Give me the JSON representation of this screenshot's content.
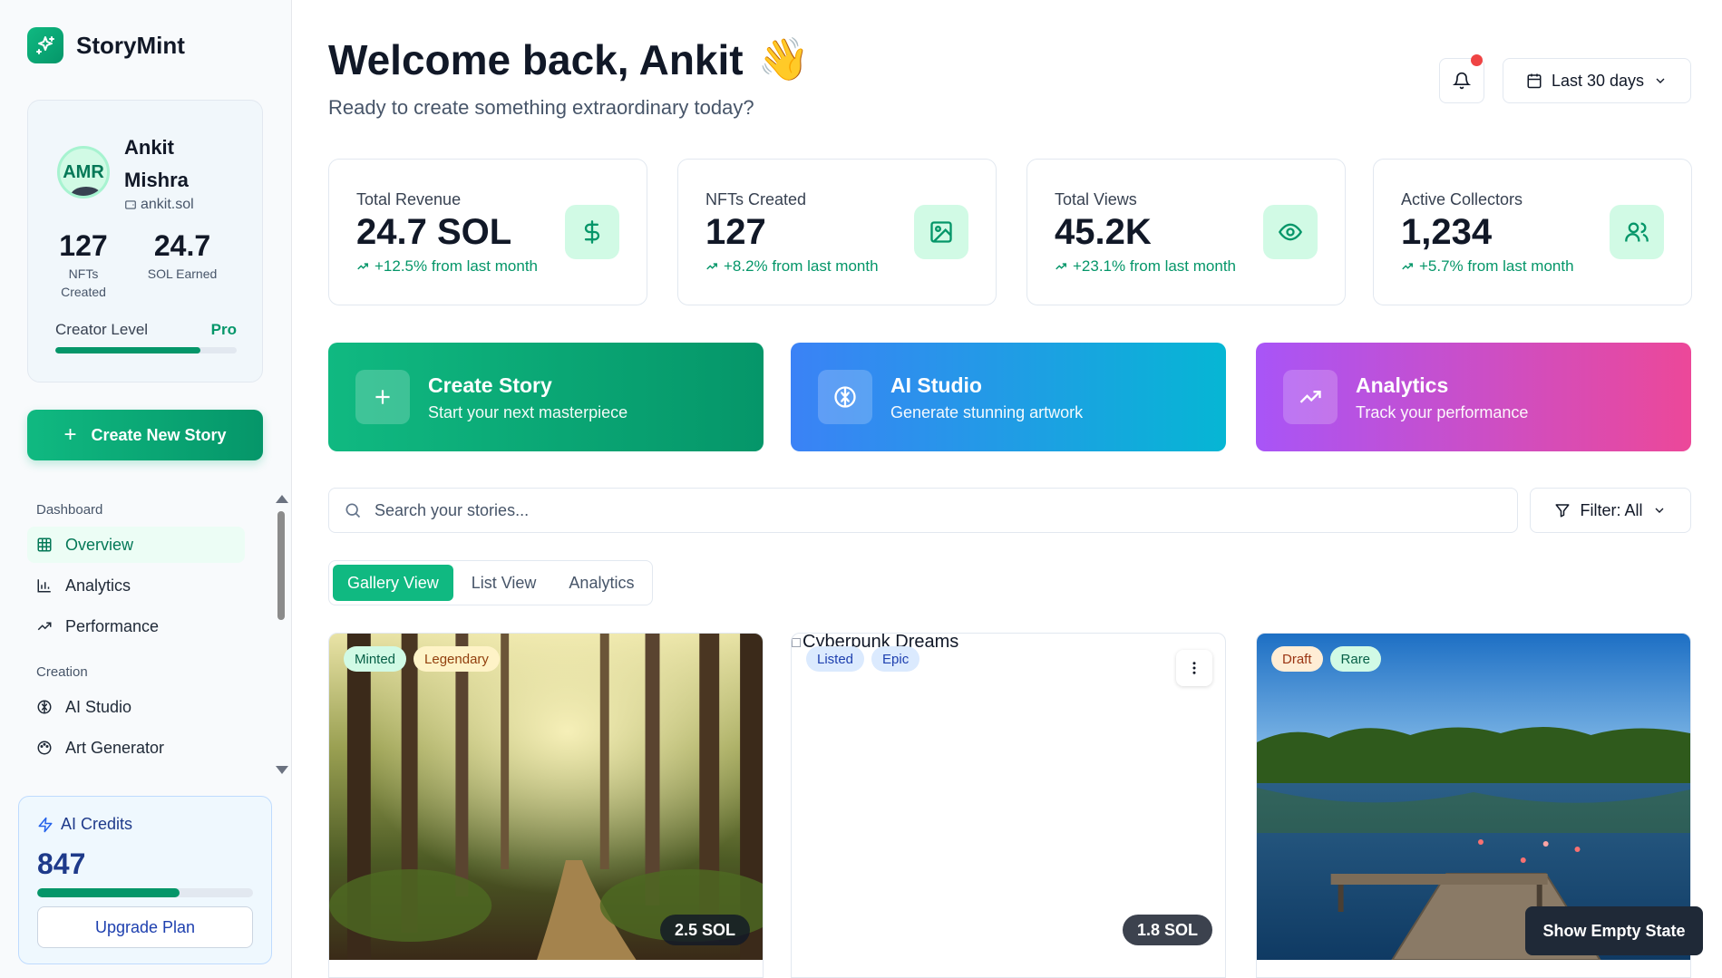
{
  "brand": {
    "name": "StoryMint"
  },
  "profile": {
    "avatar_initials": "AMR",
    "name": "Ankit Mishra",
    "handle": "ankit.sol",
    "nfts_value": "127",
    "nfts_label": "NFTs Created",
    "sol_value": "24.7",
    "sol_label": "SOL Earned",
    "level_label": "Creator Level",
    "level_value": "Pro",
    "level_progress": 0.8
  },
  "sidebar": {
    "create_button": "Create New Story",
    "sections": [
      {
        "title": "Dashboard",
        "items": [
          {
            "label": "Overview",
            "icon": "grid-icon",
            "active": true
          },
          {
            "label": "Analytics",
            "icon": "bar-chart-icon"
          },
          {
            "label": "Performance",
            "icon": "trending-up-icon"
          }
        ]
      },
      {
        "title": "Creation",
        "items": [
          {
            "label": "AI Studio",
            "icon": "brain-icon"
          },
          {
            "label": "Art Generator",
            "icon": "palette-icon"
          }
        ]
      }
    ]
  },
  "credits": {
    "title": "AI Credits",
    "value": "847",
    "progress": 0.66,
    "button": "Upgrade Plan"
  },
  "header": {
    "welcome": "Welcome back, Ankit",
    "emoji": "👋",
    "subtitle": "Ready to create something extraordinary today?",
    "date_range": "Last 30 days"
  },
  "stats": [
    {
      "label": "Total Revenue",
      "value": "24.7 SOL",
      "delta": "+12.5% from last month",
      "icon": "dollar-icon"
    },
    {
      "label": "NFTs Created",
      "value": "127",
      "delta": "+8.2% from last month",
      "icon": "image-icon"
    },
    {
      "label": "Total Views",
      "value": "45.2K",
      "delta": "+23.1% from last month",
      "icon": "eye-icon"
    },
    {
      "label": "Active Collectors",
      "value": "1,234",
      "delta": "+5.7% from last month",
      "icon": "users-icon"
    }
  ],
  "actions": [
    {
      "title": "Create Story",
      "subtitle": "Start your next masterpiece",
      "icon": "plus-icon"
    },
    {
      "title": "AI Studio",
      "subtitle": "Generate stunning artwork",
      "icon": "brain-icon"
    },
    {
      "title": "Analytics",
      "subtitle": "Track your performance",
      "icon": "trending-up-icon"
    }
  ],
  "search": {
    "placeholder": "Search your stories..."
  },
  "filter": {
    "label": "Filter: All"
  },
  "tabs": [
    "Gallery View",
    "List View",
    "Analytics"
  ],
  "stories": [
    {
      "badges": [
        "Minted",
        "Legendary"
      ],
      "price": "2.5 SOL",
      "image": "forest"
    },
    {
      "alt": "Cyberpunk Dreams",
      "badges": [
        "Listed",
        "Epic"
      ],
      "price": "1.8 SOL",
      "image": "broken"
    },
    {
      "badges": [
        "Draft",
        "Rare"
      ],
      "price": "",
      "image": "lake"
    }
  ],
  "floating_button": "Show Empty State",
  "colors": {
    "accent": "#10b981",
    "accent_dark": "#059669",
    "alert": "#ef4444"
  }
}
